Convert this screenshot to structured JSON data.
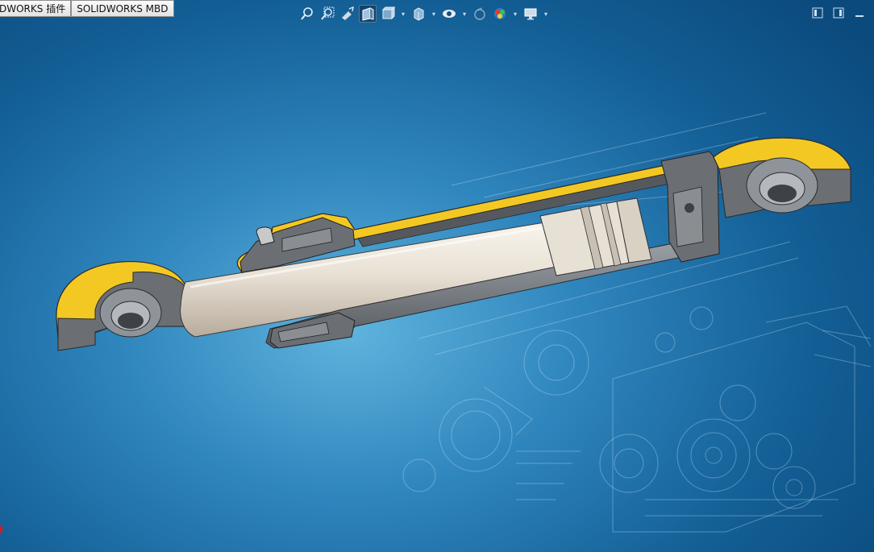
{
  "tabs": [
    {
      "label": "DWORKS 插件"
    },
    {
      "label": "SOLIDWORKS MBD"
    }
  ],
  "heads_up_toolbar": {
    "buttons": [
      {
        "icon": "zoom-to-fit-icon"
      },
      {
        "icon": "zoom-to-area-icon"
      },
      {
        "icon": "previous-view-icon"
      },
      {
        "icon": "section-view-icon",
        "active": true
      },
      {
        "icon": "view-orientation-icon"
      },
      {
        "icon": "display-style-icon"
      },
      {
        "icon": "hide-show-items-icon"
      },
      {
        "icon": "edit-appearance-icon"
      },
      {
        "icon": "apply-scene-icon"
      },
      {
        "icon": "view-settings-icon"
      }
    ]
  },
  "window_controls": [
    "tile-left-icon",
    "tile-right-icon",
    "minimize-icon"
  ],
  "viewport": {
    "model": "hydraulic-cylinder-section-view",
    "colors": {
      "section_face": "#f3c823",
      "cut_gray": "#6b6f74",
      "rod": "#ede6dc",
      "background_center": "#5fb3dd",
      "background_edge": "#0b4a7d"
    }
  }
}
